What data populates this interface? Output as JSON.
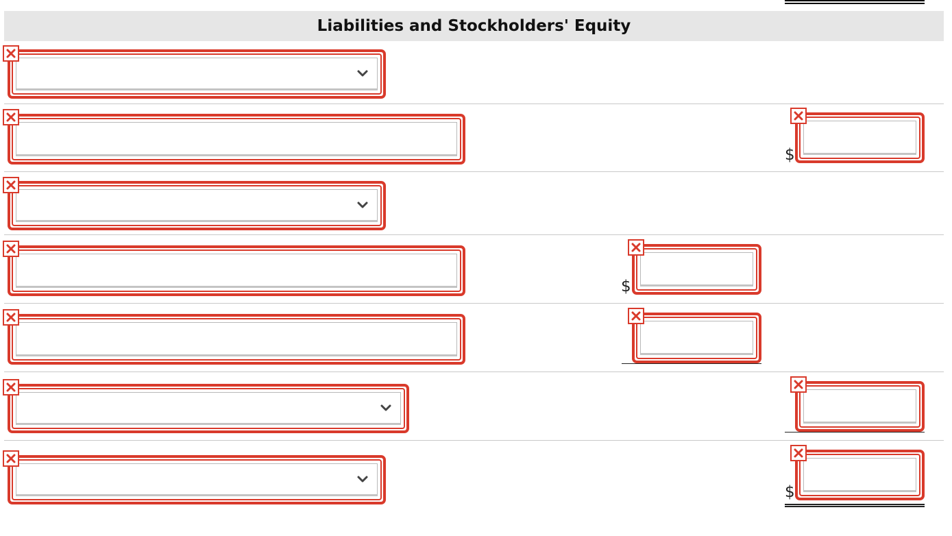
{
  "header": {
    "title": "Liabilities and Stockholders' Equity"
  },
  "symbols": {
    "currency": "$"
  },
  "icons": {
    "error": "error-x-icon",
    "dropdown": "chevron-down-icon"
  },
  "colors": {
    "error_red": "#d93a2b",
    "header_bg": "#e6e6e6"
  },
  "rows": [
    {
      "type": "select",
      "selected_value": ""
    },
    {
      "type": "text",
      "value": "",
      "amount": ""
    },
    {
      "type": "select",
      "selected_value": ""
    },
    {
      "type": "text",
      "value": "",
      "amount": ""
    },
    {
      "type": "text",
      "value": "",
      "amount": ""
    },
    {
      "type": "select",
      "selected_value": "",
      "amount": ""
    },
    {
      "type": "select",
      "selected_value": "",
      "amount": ""
    }
  ]
}
